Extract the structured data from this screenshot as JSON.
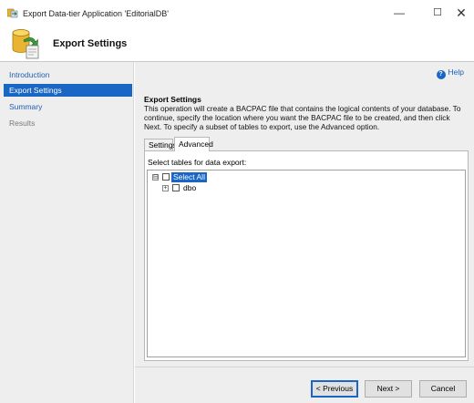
{
  "window": {
    "title": "Export Data-tier Application 'EditorialDB'",
    "minimize_glyph": "—",
    "maximize_glyph": "☐",
    "close_glyph": "✕"
  },
  "header": {
    "title": "Export Settings"
  },
  "sidebar": {
    "items": [
      {
        "label": "Introduction",
        "state": "link"
      },
      {
        "label": "Export Settings",
        "state": "active"
      },
      {
        "label": "Summary",
        "state": "link"
      },
      {
        "label": "Results",
        "state": "disabled"
      }
    ]
  },
  "main": {
    "help_label": "Help",
    "section_title": "Export Settings",
    "description": "This operation will create a BACPAC file that contains the logical contents of your database. To continue, specify the location where you want the BACPAC file to be created, and then click Next. To specify a subset of tables to export, use the Advanced option.",
    "tabs": [
      {
        "label": "Settings"
      },
      {
        "label": "Advanced"
      }
    ],
    "active_tab": "Advanced",
    "tables_label": "Select tables for data export:",
    "tree": {
      "root": {
        "label": "Select All",
        "expander": "⊟",
        "checked": false
      },
      "children": [
        {
          "label": "dbo",
          "expander": "+",
          "checked": false
        }
      ]
    }
  },
  "footer": {
    "previous_label": "< Previous",
    "next_label": "Next >",
    "cancel_label": "Cancel"
  },
  "colors": {
    "accent": "#1a66c4",
    "link": "#1e5fb5",
    "panel_bg": "#eeeeee"
  },
  "icons": [
    "app-icon",
    "export-database-icon",
    "help-icon",
    "collapse-icon",
    "expand-icon"
  ]
}
